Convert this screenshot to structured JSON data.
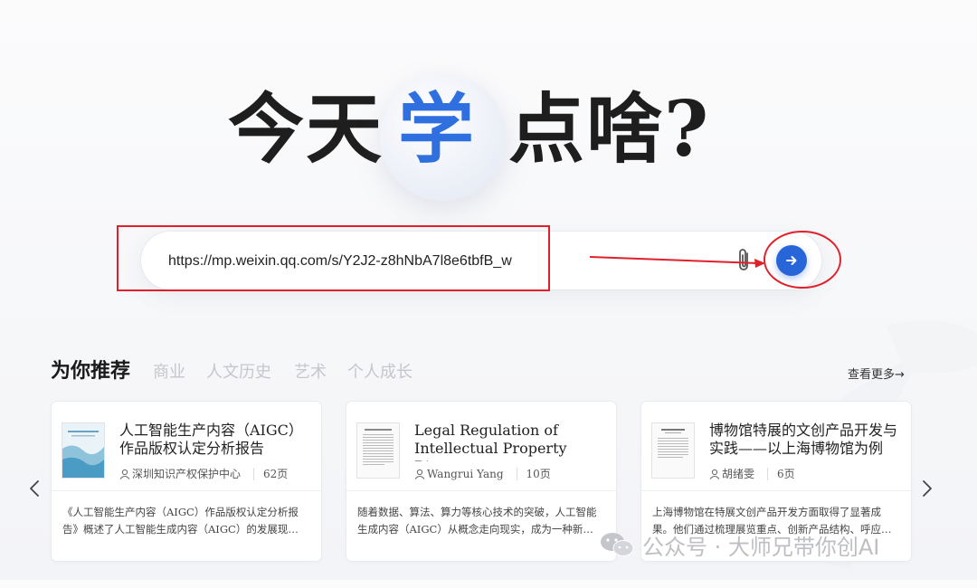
{
  "hero": {
    "left": "今天",
    "accent": "学",
    "right": "点啥?"
  },
  "search": {
    "value": "https://mp.weixin.qq.com/s/Y2J2-z8hNbA7l8e6tbfB_w"
  },
  "recommend": {
    "title": "为你推荐",
    "tabs": [
      "商业",
      "人文历史",
      "艺术",
      "个人成长"
    ],
    "view_more": "查看更多→",
    "cards": [
      {
        "title": "人工智能生产内容（AIGC）作品版权认定分析报告",
        "author": "深圳知识产权保护中心",
        "pages": "62页",
        "desc": "《人工智能生产内容（AIGC）作品版权认定分析报告》概述了人工智能生成内容（AIGC）的发展现…"
      },
      {
        "title": "Legal Regulation of Intellectual Property Rig…",
        "author": "Wangrui Yang",
        "pages": "10页",
        "desc": "随着数据、算法、算力等核心技术的突破，人工智能生成内容（AIGC）从概念走向现实，成为一种新…"
      },
      {
        "title": "博物馆特展的文创产品开发与实践——以上海博物馆为例",
        "author": "胡绪雯",
        "pages": "6页",
        "desc": "上海博物馆在特展文创产品开发方面取得了显著成果。他们通过梳理展览重点、创新产品结构、呼应…"
      }
    ]
  },
  "watermark": "公众号 · 大师兄带你创AI",
  "colors": {
    "accent": "#2865d8",
    "annotation": "#e0202a"
  }
}
